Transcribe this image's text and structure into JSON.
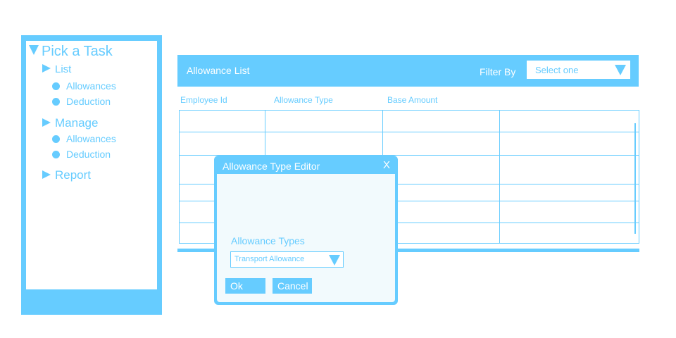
{
  "sidebar": {
    "title": "Pick a Task",
    "groups": [
      {
        "label": "List",
        "items": [
          "Allowances",
          "Deduction"
        ]
      },
      {
        "label": "Manage",
        "items": [
          "Allowances",
          "Deduction"
        ]
      },
      {
        "label": "Report",
        "items": []
      }
    ]
  },
  "header": {
    "title": "Allowance List",
    "filter_label": "Filter By",
    "filter_select_value": "Select one"
  },
  "table": {
    "columns": [
      "Employee Id",
      "Allowance Type",
      "Base Amount",
      ""
    ],
    "rows": [
      [
        "",
        "",
        "",
        ""
      ],
      [
        "",
        "",
        "",
        ""
      ],
      [
        "",
        "",
        "",
        ""
      ],
      [
        "",
        "",
        "",
        ""
      ],
      [
        "",
        "",
        "",
        ""
      ],
      [
        "",
        "",
        "",
        ""
      ]
    ]
  },
  "dialog": {
    "title": "Allowance Type Editor",
    "close_label": "X",
    "field_label": "Allowance Types",
    "field_value": "Transport Allowance",
    "ok_label": "Ok",
    "cancel_label": "Cancel"
  },
  "colors": {
    "accent": "#66ccff",
    "dialog_body": "#f2fafd",
    "background": "#ffffff"
  }
}
